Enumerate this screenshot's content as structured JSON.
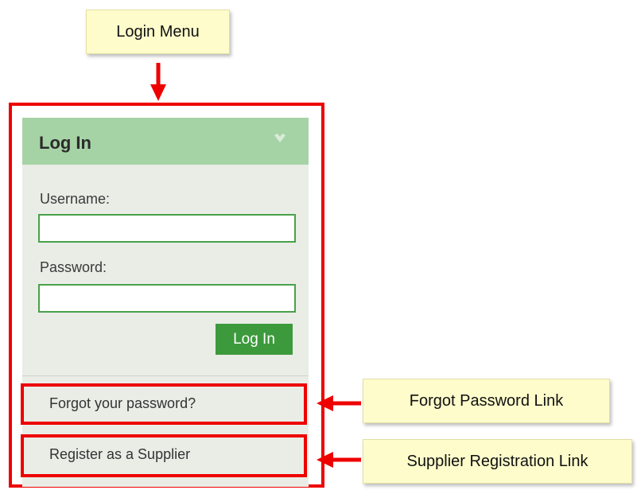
{
  "callouts": {
    "login_menu": "Login Menu",
    "forgot_password_link": "Forgot Password Link",
    "supplier_registration_link": "Supplier Registration Link"
  },
  "panel": {
    "title": "Log In",
    "username_label": "Username:",
    "username_value": "",
    "password_label": "Password:",
    "password_value": "",
    "login_button": "Log In"
  },
  "links": {
    "forgot_password": "Forgot your password?",
    "register_supplier": "Register as a Supplier"
  },
  "colors": {
    "highlight_red": "#ee0000",
    "header_green": "#a6d3a6",
    "button_green": "#3c9a3c",
    "input_border_green": "#49a14a",
    "panel_background": "#eaede6",
    "callout_yellow": "#fefccb"
  },
  "icons": {
    "collapse": "chevron-down-icon",
    "pointer": "arrow-icon"
  }
}
